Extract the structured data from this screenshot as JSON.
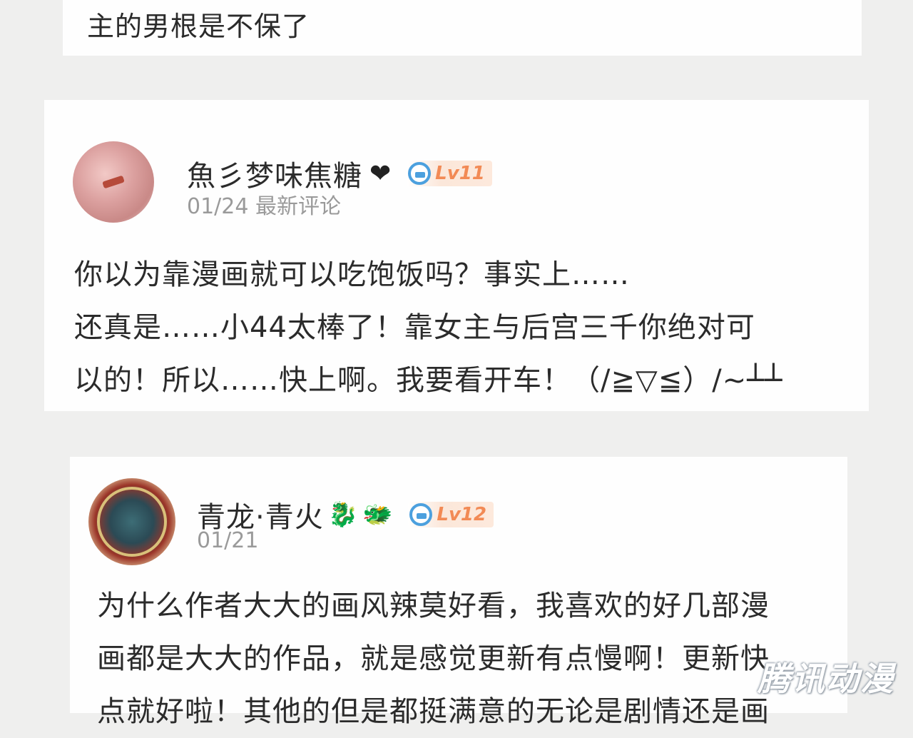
{
  "top_comment": {
    "text": "主的男根是不保了"
  },
  "comments": [
    {
      "username": "魚彡梦味焦糖",
      "heart": "❤",
      "level": "Lv11",
      "meta": "01/24 最新评论",
      "lines": [
        "你以为靠漫画就可以吃饱饭吗？事实上……",
        "还真是……小44太棒了！靠女主与后宫三千你绝对可",
        "以的！所以……快上啊。我要看开车！（/≧▽≦）/~┴┴"
      ]
    },
    {
      "username": "青龙·青火",
      "emojis": [
        "🐉",
        "🐲"
      ],
      "level": "Lv12",
      "meta": "01/21",
      "lines": [
        "为什么作者大大的画风辣莫好看，我喜欢的好几部漫",
        "画都是大大的作品，就是感觉更新有点慢啊！更新快",
        "点就好啦！其他的但是都挺满意的无论是剧情还是画"
      ]
    }
  ],
  "watermark": "腾讯动漫",
  "colors": {
    "background": "#efefee",
    "card": "#fefefe",
    "level_text": "#f28a55",
    "level_icon": "#4ca0de",
    "meta_text": "#9a9a9a"
  }
}
